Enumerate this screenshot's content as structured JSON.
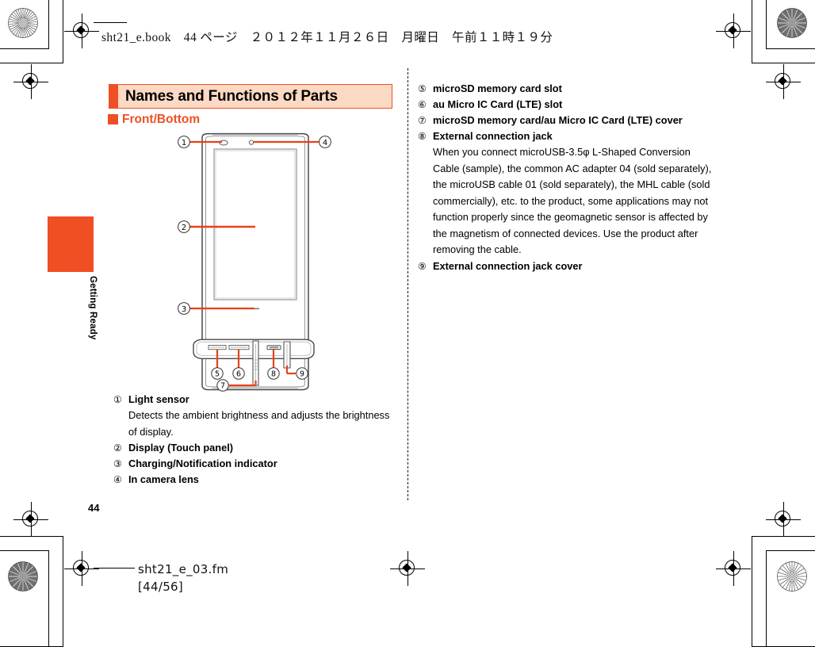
{
  "header": {
    "line": "sht21_e.book　44 ページ　２０１２年１１月２６日　月曜日　午前１１時１９分"
  },
  "side_tab": {
    "label": "Getting Ready"
  },
  "page": {
    "number": "44",
    "footer_file": "sht21_e_03.fm",
    "footer_range": "[44/56]"
  },
  "section": {
    "title": "Names and Functions of Parts",
    "subheading": "Front/Bottom"
  },
  "colors": {
    "accent": "#ef5023",
    "title_fill": "#fbd9c3",
    "tab": "#f04e23",
    "leader": "#e8411a"
  },
  "left_items": [
    {
      "num": "①",
      "term": "Light sensor",
      "desc": "Detects the ambient brightness and adjusts the brightness of display."
    },
    {
      "num": "②",
      "term": "Display (Touch panel)",
      "desc": ""
    },
    {
      "num": "③",
      "term": "Charging/Notification indicator",
      "desc": ""
    },
    {
      "num": "④",
      "term": "In camera lens",
      "desc": ""
    }
  ],
  "right_items": [
    {
      "num": "⑤",
      "term": "microSD memory card slot",
      "desc": ""
    },
    {
      "num": "⑥",
      "term": "au Micro IC Card (LTE) slot",
      "desc": ""
    },
    {
      "num": "⑦",
      "term": "microSD memory card/au Micro IC Card (LTE) cover",
      "desc": ""
    },
    {
      "num": "⑧",
      "term": "External connection jack",
      "desc": "When you connect microUSB-3.5φ L-Shaped Conversion Cable (sample), the common AC adapter 04 (sold separately), the microUSB cable 01 (sold separately), the MHL cable (sold commercially), etc. to the product, some applications may not function properly since the geomagnetic sensor is affected by the magnetism of connected devices. Use the product after removing the cable."
    },
    {
      "num": "⑨",
      "term": "External connection jack cover",
      "desc": ""
    }
  ],
  "diagram_front": {
    "callouts": [
      "①",
      "②",
      "③",
      "④"
    ]
  },
  "diagram_bottom": {
    "callouts": [
      "⑤",
      "⑥",
      "⑦",
      "⑧",
      "⑨"
    ]
  }
}
